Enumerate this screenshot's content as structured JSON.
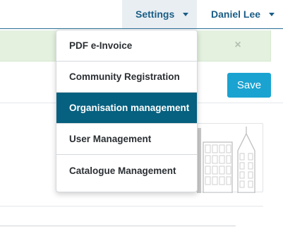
{
  "nav": {
    "settings_label": "Settings",
    "user_label": "Daniel Lee"
  },
  "alert": {
    "close_glyph": "×"
  },
  "toolbar": {
    "save_label": "Save"
  },
  "settings_menu": {
    "items": [
      {
        "label": "PDF e-Invoice",
        "active": false
      },
      {
        "label": "Community Registration",
        "active": false
      },
      {
        "label": "Organisation management",
        "active": true
      },
      {
        "label": "User Management",
        "active": false
      },
      {
        "label": "Catalogue Management",
        "active": false
      }
    ]
  },
  "colors": {
    "brand_text": "#1a5d86",
    "active_menu_bg": "#06607f",
    "save_button": "#1aa3d1",
    "alert_bg": "#e4f1df"
  },
  "icons": {
    "caret": "chevron-down-icon",
    "close": "close-icon",
    "placeholder_image": "building-icon"
  }
}
